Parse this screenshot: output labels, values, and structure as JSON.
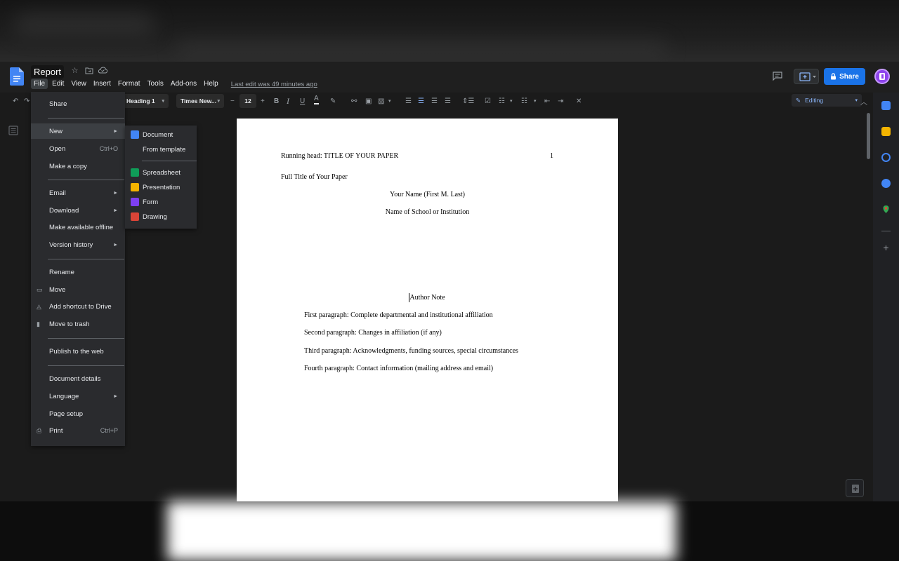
{
  "document": {
    "title": "Report",
    "last_edit": "Last edit was 49 minutes ago"
  },
  "menubar": [
    "File",
    "Edit",
    "View",
    "Insert",
    "Format",
    "Tools",
    "Add-ons",
    "Help"
  ],
  "header_actions": {
    "share_label": "Share"
  },
  "toolbar": {
    "style": "Heading 1",
    "font": "Times New...",
    "font_size": "12",
    "mode": "Editing"
  },
  "file_menu": {
    "items": [
      {
        "label": "Share",
        "shortcut": "",
        "submenu": false,
        "icon": ""
      },
      {
        "label": "New",
        "shortcut": "",
        "submenu": true,
        "icon": ""
      },
      {
        "label": "Open",
        "shortcut": "Ctrl+O",
        "submenu": false,
        "icon": ""
      },
      {
        "label": "Make a copy",
        "shortcut": "",
        "submenu": false,
        "icon": ""
      },
      {
        "label": "Email",
        "shortcut": "",
        "submenu": true,
        "icon": ""
      },
      {
        "label": "Download",
        "shortcut": "",
        "submenu": true,
        "icon": ""
      },
      {
        "label": "Make available offline",
        "shortcut": "",
        "submenu": false,
        "icon": ""
      },
      {
        "label": "Version history",
        "shortcut": "",
        "submenu": true,
        "icon": ""
      },
      {
        "label": "Rename",
        "shortcut": "",
        "submenu": false,
        "icon": ""
      },
      {
        "label": "Move",
        "shortcut": "",
        "submenu": false,
        "icon": "folder-move-icon"
      },
      {
        "label": "Add shortcut to Drive",
        "shortcut": "",
        "submenu": false,
        "icon": "drive-shortcut-icon"
      },
      {
        "label": "Move to trash",
        "shortcut": "",
        "submenu": false,
        "icon": "trash-icon"
      },
      {
        "label": "Publish to the web",
        "shortcut": "",
        "submenu": false,
        "icon": ""
      },
      {
        "label": "Document details",
        "shortcut": "",
        "submenu": false,
        "icon": ""
      },
      {
        "label": "Language",
        "shortcut": "",
        "submenu": true,
        "icon": ""
      },
      {
        "label": "Page setup",
        "shortcut": "",
        "submenu": false,
        "icon": ""
      },
      {
        "label": "Print",
        "shortcut": "Ctrl+P",
        "submenu": false,
        "icon": "printer-icon"
      }
    ]
  },
  "new_submenu": {
    "items": [
      {
        "label": "Document",
        "icon": "docs-icon",
        "color": "#4285f4"
      },
      {
        "label": "From template",
        "icon": "",
        "color": ""
      },
      {
        "label": "Spreadsheet",
        "icon": "sheets-icon",
        "color": "#0f9d58"
      },
      {
        "label": "Presentation",
        "icon": "slides-icon",
        "color": "#f4b400"
      },
      {
        "label": "Form",
        "icon": "forms-icon",
        "color": "#7e3ff2"
      },
      {
        "label": "Drawing",
        "icon": "drawings-icon",
        "color": "#db4437"
      }
    ]
  },
  "page": {
    "running_head": "Running head: TITLE OF YOUR PAPER",
    "page_number": "1",
    "full_title": "Full Title of Your Paper",
    "author": "Your Name (First M. Last)",
    "institution": "Name of School or Institution",
    "author_note": "Author Note",
    "paragraphs": [
      "First paragraph: Complete departmental and institutional affiliation",
      "Second paragraph: Changes in affiliation (if any)",
      "Third paragraph: Acknowledgments, funding sources, special circumstances",
      "Fourth paragraph: Contact information (mailing address and email)"
    ]
  },
  "colors": {
    "accent": "#1a73e8",
    "avatar": "#8e44ec"
  }
}
